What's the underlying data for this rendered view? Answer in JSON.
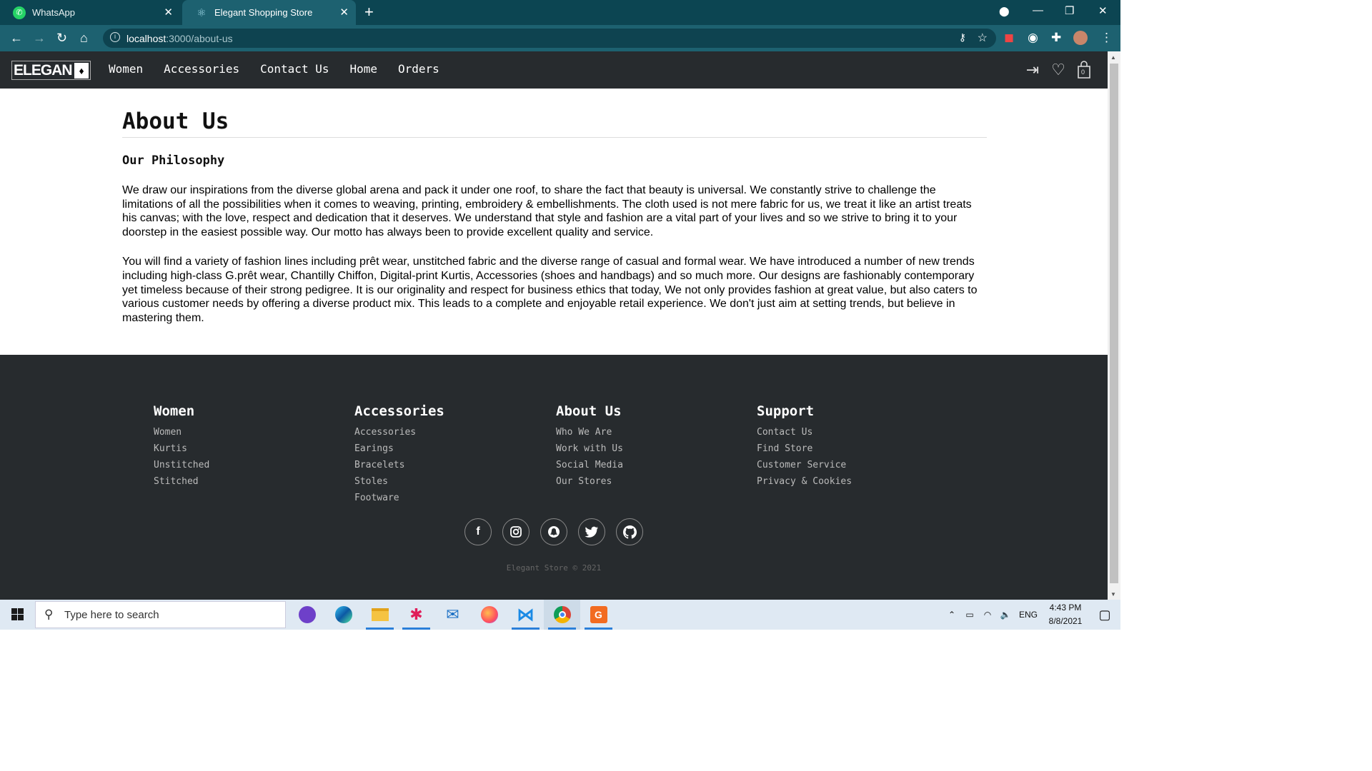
{
  "browser": {
    "tabs": [
      {
        "title": "WhatsApp",
        "icon": "whatsapp-icon"
      },
      {
        "title": "Elegant Shopping Store",
        "icon": "react-icon"
      }
    ],
    "url_host": "localhost",
    "url_path": ":3000/about-us",
    "accent_color": "#1d6170"
  },
  "site": {
    "logo_text": "ELEGAN",
    "nav": [
      "Women",
      "Accessories",
      "Contact Us",
      "Home",
      "Orders"
    ],
    "cart_count": "0"
  },
  "page": {
    "title": "About Us",
    "subtitle": "Our Philosophy",
    "paragraphs": [
      "We draw our inspirations from the diverse global arena and pack it under one roof, to share the fact that beauty is universal. We constantly strive to challenge the limitations of all the possibilities when it comes to weaving, printing, embroidery & embellishments. The cloth used is not mere fabric for us, we treat it like an artist treats his canvas; with the love, respect and dedication that it deserves. We understand that style and fashion are a vital part of your lives and so we strive to bring it to your doorstep in the easiest possible way. Our motto has always been to provide excellent quality and service.",
      "You will find a variety of fashion lines including prêt wear, unstitched fabric and the diverse range of casual and formal wear. We have introduced a number of new trends including high-class G.prêt wear, Chantilly Chiffon, Digital-print Kurtis, Accessories (shoes and handbags) and so much more. Our designs are fashionably contemporary yet timeless because of their strong pedigree. It is our originality and respect for business ethics that today, We not only provides fashion at great value, but also caters to various customer needs by offering a diverse product mix. This leads to a complete and enjoyable retail experience. We don't just aim at setting trends, but believe in mastering them."
    ]
  },
  "footer": {
    "columns": [
      {
        "heading": "Women",
        "links": [
          "Women",
          "Kurtis",
          "Unstitched",
          "Stitched"
        ]
      },
      {
        "heading": "Accessories",
        "links": [
          "Accessories",
          "Earings",
          "Bracelets",
          "Stoles",
          "Footware"
        ]
      },
      {
        "heading": "About Us",
        "links": [
          "Who We Are",
          "Work with Us",
          "Social Media",
          "Our Stores"
        ]
      },
      {
        "heading": "Support",
        "links": [
          "Contact Us",
          "Find Store",
          "Customer Service",
          "Privacy & Cookies"
        ]
      }
    ],
    "socials": [
      "facebook-icon",
      "instagram-icon",
      "snapchat-icon",
      "twitter-icon",
      "github-icon"
    ],
    "copyright": "Elegant Store © 2021"
  },
  "taskbar": {
    "search_placeholder": "Type here to search",
    "language": "ENG",
    "time": "4:43 PM",
    "date": "8/8/2021"
  }
}
